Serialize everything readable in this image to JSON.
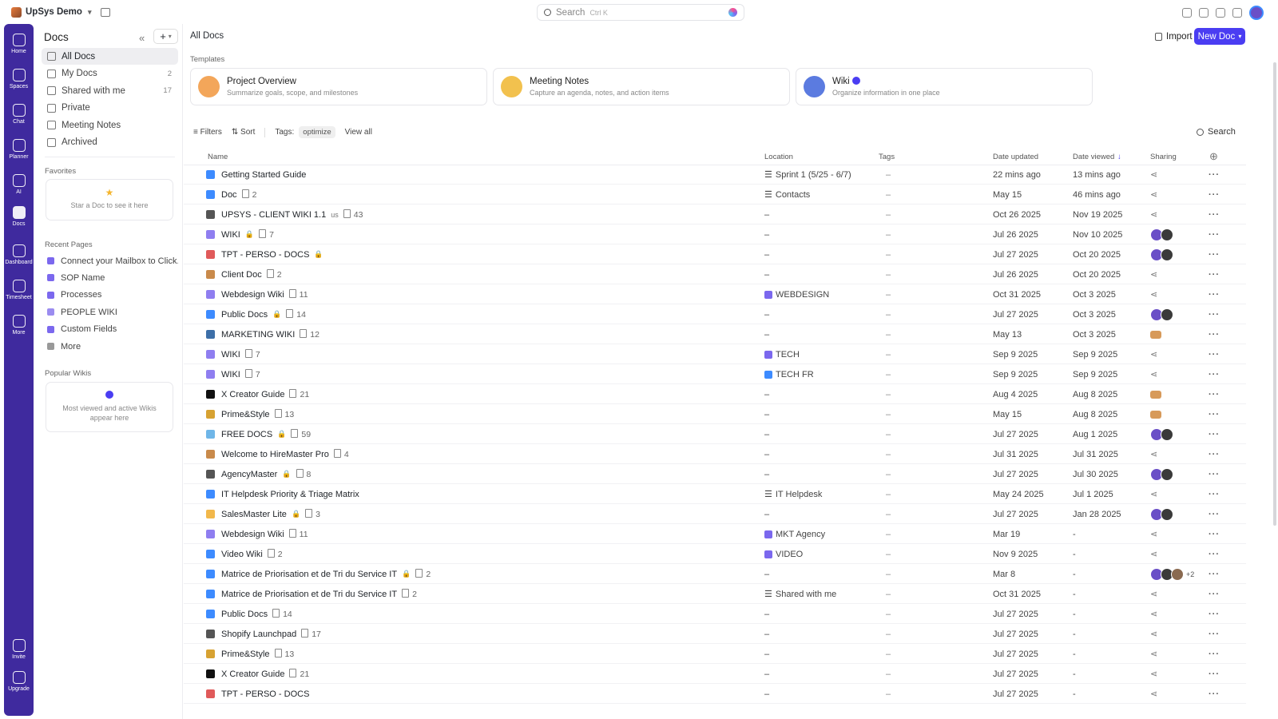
{
  "topbar": {
    "workspace": "UpSys Demo",
    "search_placeholder": "Search",
    "search_shortcut": "Ctrl K"
  },
  "rail": [
    {
      "label": "Home",
      "icon": "home-icon"
    },
    {
      "label": "Spaces",
      "icon": "spaces-icon"
    },
    {
      "label": "Chat",
      "icon": "chat-icon"
    },
    {
      "label": "Planner",
      "icon": "planner-icon"
    },
    {
      "label": "AI",
      "icon": "ai-icon"
    },
    {
      "label": "Docs",
      "icon": "docs-icon"
    },
    {
      "label": "Dashboard",
      "icon": "dashboard-icon"
    },
    {
      "label": "Timesheet",
      "icon": "timesheet-icon"
    },
    {
      "label": "More",
      "icon": "grid-icon"
    },
    {
      "label": "Invite",
      "icon": "invite-icon"
    },
    {
      "label": "Upgrade",
      "icon": "upgrade-icon"
    }
  ],
  "sidebar": {
    "title": "Docs",
    "items": [
      {
        "label": "All Docs",
        "count": ""
      },
      {
        "label": "My Docs",
        "count": "2"
      },
      {
        "label": "Shared with me",
        "count": "17"
      },
      {
        "label": "Private",
        "count": ""
      },
      {
        "label": "Meeting Notes",
        "count": ""
      },
      {
        "label": "Archived",
        "count": ""
      }
    ],
    "favorites_header": "Favorites",
    "favorites_empty": "Star a Doc to see it here",
    "recent_header": "Recent Pages",
    "recent": [
      {
        "label": "Connect your Mailbox to Click...",
        "color": "#7b68ee"
      },
      {
        "label": "SOP Name",
        "color": "#7b68ee"
      },
      {
        "label": "Processes",
        "color": "#7b68ee"
      },
      {
        "label": "PEOPLE WIKI",
        "color": "#9b8cf0"
      },
      {
        "label": "Custom Fields",
        "color": "#7b68ee"
      },
      {
        "label": "More",
        "color": "#999999"
      }
    ],
    "wikis_header": "Popular Wikis",
    "wikis_empty_1": "Most viewed and active Wikis",
    "wikis_empty_2": "appear here"
  },
  "main": {
    "title": "All Docs",
    "import": "Import",
    "new_doc": "New Doc",
    "templates_header": "Templates",
    "templates": [
      {
        "title": "Project Overview",
        "subtitle": "Summarize goals, scope, and milestones",
        "color": "#f3a65a"
      },
      {
        "title": "Meeting Notes",
        "subtitle": "Capture an agenda, notes, and action items",
        "color": "#f2c14e"
      },
      {
        "title": "Wiki",
        "subtitle": "Organize information in one place",
        "color": "#5b7be0"
      }
    ],
    "toolbar": {
      "filters": "Filters",
      "sort": "Sort",
      "tags_label": "Tags:",
      "tag": "optimize",
      "view_all": "View all",
      "search": "Search"
    },
    "columns": {
      "name": "Name",
      "location": "Location",
      "tags": "Tags",
      "updated": "Date updated",
      "viewed": "Date viewed",
      "sharing": "Sharing"
    }
  },
  "rows": [
    {
      "icon": "#3d8bff",
      "name": "Getting Started Guide",
      "lock": false,
      "pages": "",
      "loc_icon": "list",
      "location": "Sprint 1 (5/25 - 6/7)",
      "tags": "–",
      "updated": "22 mins ago",
      "viewed": "13 mins ago",
      "share": "icon"
    },
    {
      "icon": "#3d8bff",
      "name": "Doc",
      "lock": false,
      "pages": "2",
      "loc_icon": "list",
      "location": "Contacts",
      "tags": "–",
      "updated": "May 15",
      "viewed": "46 mins ago",
      "share": "icon"
    },
    {
      "icon": "#555555",
      "name": "UPSYS - CLIENT WIKI 1.1",
      "suffix": "us",
      "lock": false,
      "pages": "43",
      "loc_icon": "",
      "location": "–",
      "tags": "–",
      "updated": "Oct 26 2025",
      "viewed": "Nov 19 2025",
      "share": "icon"
    },
    {
      "icon": "#8f7ef0",
      "name": "WIKI",
      "lock": true,
      "pages": "7",
      "loc_icon": "",
      "location": "–",
      "tags": "–",
      "updated": "Jul 26 2025",
      "viewed": "Nov 10 2025",
      "share": "avatars2"
    },
    {
      "icon": "#e05a5a",
      "name": "TPT - PERSO - DOCS",
      "lock": true,
      "pages": "",
      "loc_icon": "",
      "location": "–",
      "tags": "–",
      "updated": "Jul 27 2025",
      "viewed": "Oct 20 2025",
      "share": "avatars2"
    },
    {
      "icon": "#c98a4b",
      "name": "Client Doc",
      "lock": false,
      "pages": "2",
      "loc_icon": "",
      "location": "–",
      "tags": "–",
      "updated": "Jul 26 2025",
      "viewed": "Oct 20 2025",
      "share": "icon"
    },
    {
      "icon": "#8f7ef0",
      "name": "Webdesign Wiki",
      "lock": false,
      "pages": "11",
      "loc_icon": "purple",
      "location": "WEBDESIGN",
      "tags": "–",
      "updated": "Oct 31 2025",
      "viewed": "Oct 3 2025",
      "share": "icon"
    },
    {
      "icon": "#3d8bff",
      "name": "Public Docs",
      "lock": true,
      "pages": "14",
      "loc_icon": "",
      "location": "–",
      "tags": "–",
      "updated": "Jul 27 2025",
      "viewed": "Oct 3 2025",
      "share": "avatars2"
    },
    {
      "icon": "#3d6fa8",
      "name": "MARKETING WIKI",
      "lock": false,
      "pages": "12",
      "loc_icon": "",
      "location": "–",
      "tags": "–",
      "updated": "May 13",
      "viewed": "Oct 3 2025",
      "share": "box"
    },
    {
      "icon": "#8f7ef0",
      "name": "WIKI",
      "lock": false,
      "pages": "7",
      "loc_icon": "purple",
      "location": "TECH",
      "tags": "–",
      "updated": "Sep 9 2025",
      "viewed": "Sep 9 2025",
      "share": "icon"
    },
    {
      "icon": "#8f7ef0",
      "name": "WIKI",
      "lock": false,
      "pages": "7",
      "loc_icon": "blue",
      "location": "TECH FR",
      "tags": "–",
      "updated": "Sep 9 2025",
      "viewed": "Sep 9 2025",
      "share": "icon"
    },
    {
      "icon": "#111111",
      "name": "X Creator Guide",
      "lock": false,
      "pages": "21",
      "loc_icon": "",
      "location": "–",
      "tags": "–",
      "updated": "Aug 4 2025",
      "viewed": "Aug 8 2025",
      "share": "box"
    },
    {
      "icon": "#d7a232",
      "name": "Prime&Style",
      "lock": false,
      "pages": "13",
      "loc_icon": "",
      "location": "–",
      "tags": "–",
      "updated": "May 15",
      "viewed": "Aug 8 2025",
      "share": "box"
    },
    {
      "icon": "#6fb6e8",
      "name": "FREE DOCS",
      "lock": true,
      "pages": "59",
      "loc_icon": "",
      "location": "–",
      "tags": "–",
      "updated": "Jul 27 2025",
      "viewed": "Aug 1 2025",
      "share": "avatars2"
    },
    {
      "icon": "#c98a4b",
      "name": "Welcome to HireMaster Pro",
      "lock": false,
      "pages": "4",
      "loc_icon": "",
      "location": "–",
      "tags": "–",
      "updated": "Jul 31 2025",
      "viewed": "Jul 31 2025",
      "share": "icon"
    },
    {
      "icon": "#555555",
      "name": "AgencyMaster",
      "lock": true,
      "pages": "8",
      "loc_icon": "",
      "location": "–",
      "tags": "–",
      "updated": "Jul 27 2025",
      "viewed": "Jul 30 2025",
      "share": "avatars2"
    },
    {
      "icon": "#3d8bff",
      "name": "IT Helpdesk Priority & Triage Matrix",
      "lock": false,
      "pages": "",
      "loc_icon": "list",
      "location": "IT Helpdesk",
      "tags": "–",
      "updated": "May 24 2025",
      "viewed": "Jul 1 2025",
      "share": "icon"
    },
    {
      "icon": "#f2b84b",
      "name": "SalesMaster Lite",
      "lock": true,
      "pages": "3",
      "loc_icon": "",
      "location": "–",
      "tags": "–",
      "updated": "Jul 27 2025",
      "viewed": "Jan 28 2025",
      "share": "avatars2"
    },
    {
      "icon": "#8f7ef0",
      "name": "Webdesign Wiki",
      "lock": false,
      "pages": "11",
      "loc_icon": "purple",
      "location": "MKT Agency",
      "tags": "–",
      "updated": "Mar 19",
      "viewed": "-",
      "share": "icon"
    },
    {
      "icon": "#3d8bff",
      "name": "Video Wiki",
      "lock": false,
      "pages": "2",
      "loc_icon": "purple",
      "location": "VIDEO",
      "tags": "–",
      "updated": "Nov 9 2025",
      "viewed": "-",
      "share": "icon"
    },
    {
      "icon": "#3d8bff",
      "name": "Matrice de Priorisation et de Tri du Service IT",
      "lock": true,
      "pages": "2",
      "loc_icon": "",
      "location": "–",
      "tags": "–",
      "updated": "Mar 8",
      "viewed": "-",
      "share": "avatars3",
      "extra": "+2"
    },
    {
      "icon": "#3d8bff",
      "name": "Matrice de Priorisation et de Tri du Service IT",
      "lock": false,
      "pages": "2",
      "loc_icon": "list",
      "location": "Shared with me",
      "tags": "–",
      "updated": "Oct 31 2025",
      "viewed": "-",
      "share": "icon"
    },
    {
      "icon": "#3d8bff",
      "name": "Public Docs",
      "lock": false,
      "pages": "14",
      "loc_icon": "",
      "location": "–",
      "tags": "–",
      "updated": "Jul 27 2025",
      "viewed": "-",
      "share": "icon"
    },
    {
      "icon": "#555555",
      "name": "Shopify Launchpad",
      "lock": false,
      "pages": "17",
      "loc_icon": "",
      "location": "–",
      "tags": "–",
      "updated": "Jul 27 2025",
      "viewed": "-",
      "share": "icon"
    },
    {
      "icon": "#d7a232",
      "name": "Prime&Style",
      "lock": false,
      "pages": "13",
      "loc_icon": "",
      "location": "–",
      "tags": "–",
      "updated": "Jul 27 2025",
      "viewed": "-",
      "share": "icon"
    },
    {
      "icon": "#111111",
      "name": "X Creator Guide",
      "lock": false,
      "pages": "21",
      "loc_icon": "",
      "location": "–",
      "tags": "–",
      "updated": "Jul 27 2025",
      "viewed": "-",
      "share": "icon"
    },
    {
      "icon": "#e05a5a",
      "name": "TPT - PERSO - DOCS",
      "lock": false,
      "pages": "",
      "loc_icon": "",
      "location": "–",
      "tags": "–",
      "updated": "Jul 27 2025",
      "viewed": "-",
      "share": "icon"
    }
  ]
}
